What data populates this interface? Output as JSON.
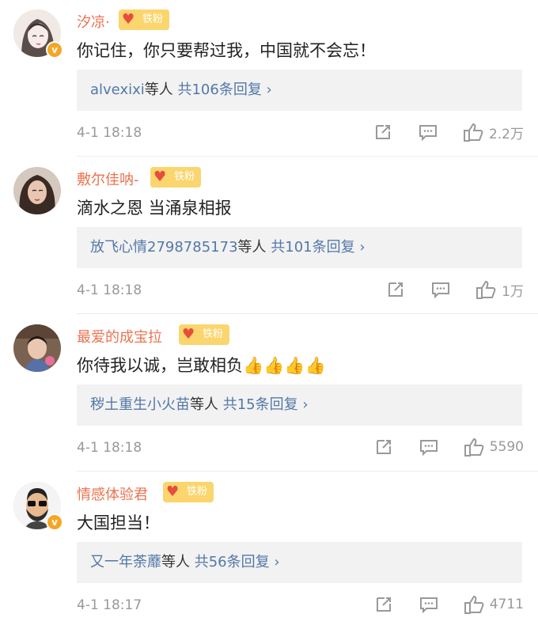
{
  "comments": [
    {
      "username": "汐凉·",
      "badge": "铁粉",
      "text": "你记住，你只要帮过我，中国就不会忘！",
      "replier": "alvexixi",
      "reply_suffix": "等人",
      "reply_count": "共106条回复 ›",
      "time": "4-1 18:18",
      "likes": "2.2万",
      "verified": true
    },
    {
      "username": "敷尔佳呐-",
      "badge": "铁粉",
      "text": "滴水之恩 当涌泉相报",
      "replier": "放飞心情2798785173",
      "reply_suffix": "等人",
      "reply_count": "共101条回复 ›",
      "time": "4-1 18:18",
      "likes": "1万",
      "verified": false
    },
    {
      "username": "最爱的成宝拉",
      "badge": "铁粉",
      "text": "你待我以诚，岂敢相负👍👍👍👍",
      "replier": "秽土重生小火苗",
      "reply_suffix": "等人",
      "reply_count": "共15条回复 ›",
      "time": "4-1 18:18",
      "likes": "5590",
      "verified": false
    },
    {
      "username": "情感体验君",
      "badge": "铁粉",
      "text": "大国担当！",
      "replier": "又一年荼蘼",
      "reply_suffix": "等人",
      "reply_count": "共56条回复 ›",
      "time": "4-1 18:17",
      "likes": "4711",
      "verified": true
    }
  ],
  "icons": {
    "share": "share-icon",
    "comment": "comment-icon",
    "like": "like-icon",
    "verified": "verified-badge-icon",
    "badge": "heart-badge-icon"
  },
  "colors": {
    "username": "#eb7350",
    "link": "#5378a8",
    "badge": "#fbd56d"
  }
}
